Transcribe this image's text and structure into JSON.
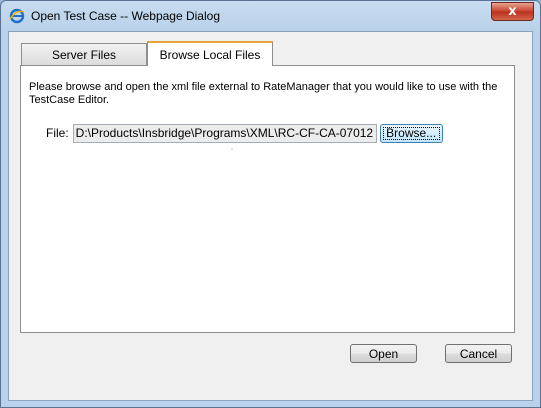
{
  "window": {
    "title": "Open Test Case -- Webpage Dialog",
    "close_label": "x",
    "title_icon": "ie-icon"
  },
  "tabs": [
    {
      "label": "Server Files",
      "active": false
    },
    {
      "label": "Browse Local Files",
      "active": true
    }
  ],
  "panel": {
    "description": "Please browse and open the xml file external to RateManager that you would like to use with the TestCase Editor.",
    "file_label": "File:",
    "file_value": "D:\\Products\\Insbridge\\Programs\\XML\\RC-CF-CA-07012",
    "browse_label": "Browse..."
  },
  "buttons": {
    "open_label": "Open",
    "cancel_label": "Cancel"
  },
  "colors": {
    "active_tab_accent": "#e8a33c",
    "close_button": "#c7402c"
  }
}
